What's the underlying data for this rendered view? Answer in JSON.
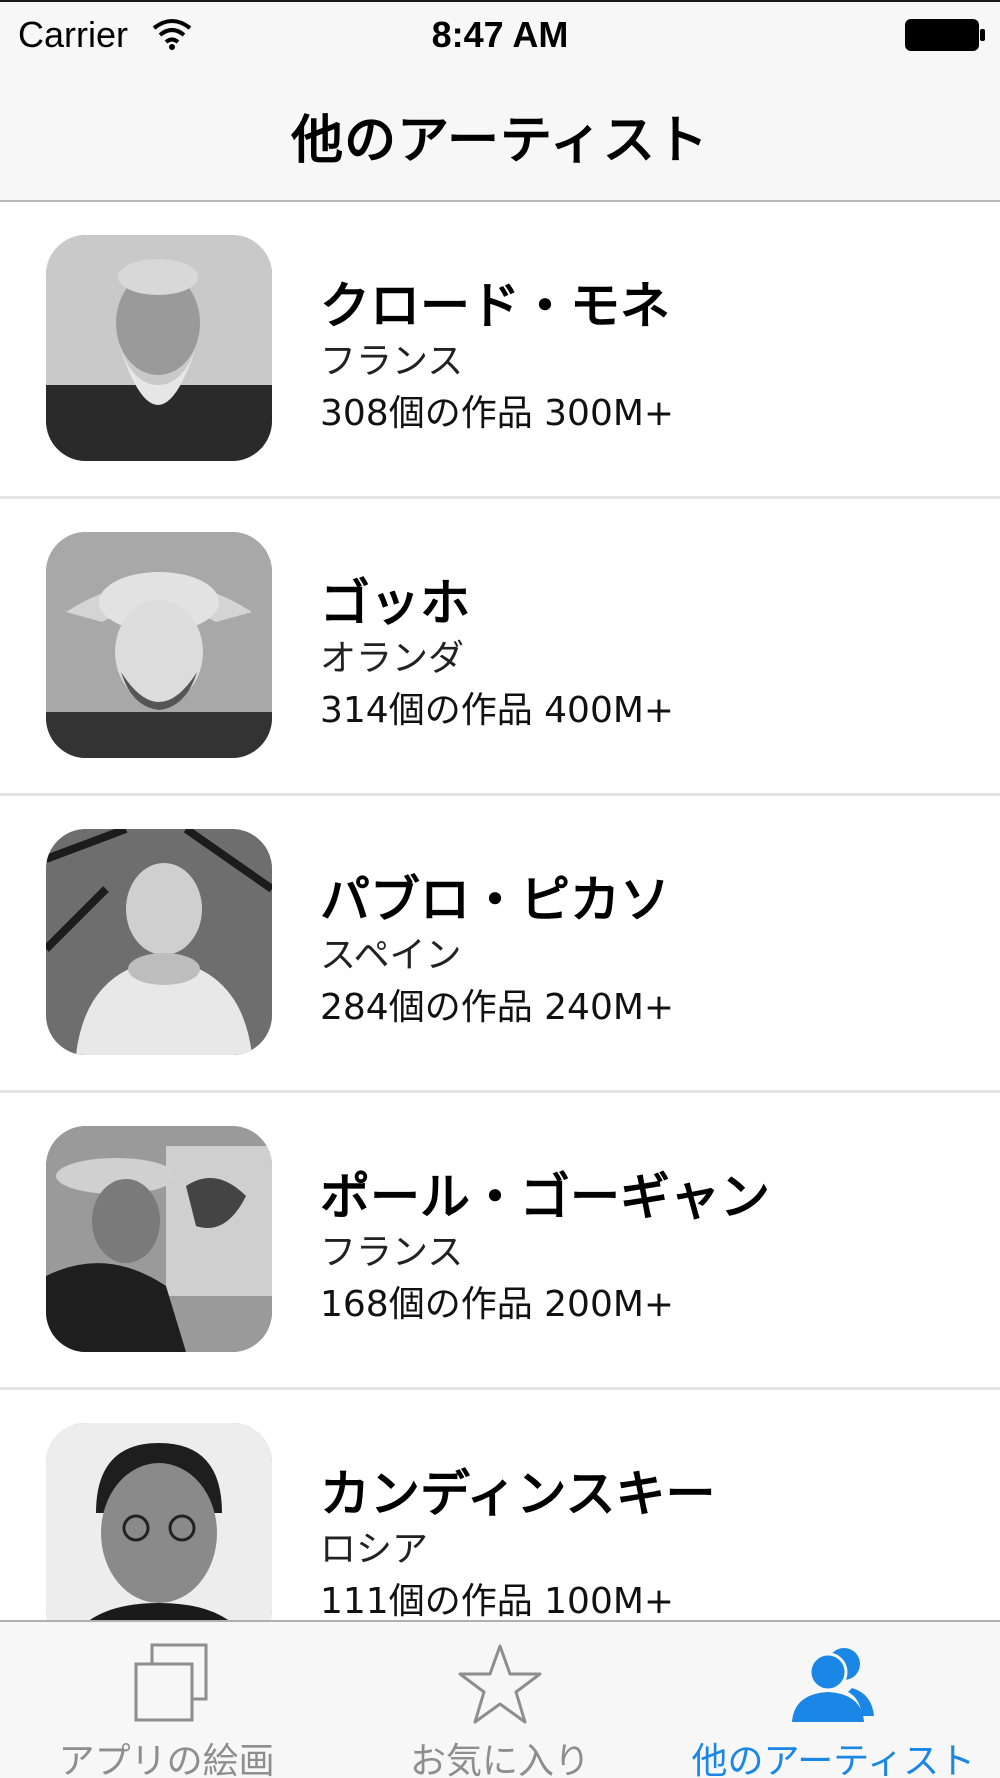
{
  "status_bar": {
    "carrier": "Carrier",
    "time": "8:47 AM"
  },
  "nav": {
    "title": "他のアーティスト"
  },
  "artists": [
    {
      "name": "クロード・モネ",
      "country": "フランス",
      "stats": "308個の作品 300M+"
    },
    {
      "name": "ゴッホ",
      "country": "オランダ",
      "stats": "314個の作品 400M+"
    },
    {
      "name": "パブロ・ピカソ",
      "country": "スペイン",
      "stats": "284個の作品 240M+"
    },
    {
      "name": "ポール・ゴーギャン",
      "country": "フランス",
      "stats": "168個の作品 200M+"
    },
    {
      "name": "カンディンスキー",
      "country": "ロシア",
      "stats": "111個の作品 100M+"
    }
  ],
  "tabs": [
    {
      "label": "アプリの絵画",
      "icon": "stacked-squares-icon",
      "active": false
    },
    {
      "label": "お気に入り",
      "icon": "star-icon",
      "active": false
    },
    {
      "label": "他のアーティスト",
      "icon": "people-icon",
      "active": true
    }
  ],
  "colors": {
    "accent": "#1a86e6",
    "inactive": "#8e8e8e",
    "bar_bg": "#f7f7f7"
  }
}
